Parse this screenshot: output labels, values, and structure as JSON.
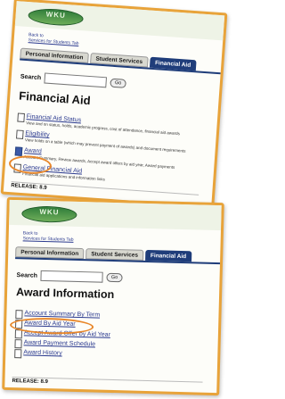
{
  "colors": {
    "highlight": "#e8a33a",
    "tab_active": "#1f3d7a",
    "link": "#2b3a8f",
    "logo_green": "#2f7d3a"
  },
  "screen1": {
    "logo": "WKU",
    "back_link": {
      "line1": "Back to",
      "line2": "Services for Students Tab"
    },
    "tabs": [
      {
        "label": "Personal Information"
      },
      {
        "label": "Student Services"
      },
      {
        "label": "Financial Aid"
      }
    ],
    "search": {
      "label": "Search",
      "placeholder": "",
      "go": "Go"
    },
    "title": "Financial Aid",
    "items": [
      {
        "label": "Financial Aid Status",
        "desc": "View and on status, holds, academic progress, cost of attendance, financial aid awards"
      },
      {
        "label": "Eligibility",
        "desc": "View holds on a table (which may prevent payment of awards) and document requirements"
      },
      {
        "label": "Award",
        "desc": "Account Summary, Review awards, Accept award offers by aid year, Award payments"
      },
      {
        "label": "General Financial Aid",
        "desc": "Financial aid applications and information links"
      }
    ],
    "release": "RELEASE: 8.9"
  },
  "screen2": {
    "logo": "WKU",
    "back_link": {
      "line1": "Back to",
      "line2": "Services for Students Tab"
    },
    "tabs": [
      {
        "label": "Personal Information"
      },
      {
        "label": "Student Services"
      },
      {
        "label": "Financial Aid"
      }
    ],
    "search": {
      "label": "Search",
      "placeholder": "",
      "go": "Go"
    },
    "title": "Award Information",
    "items": [
      {
        "label": "Account Summary By Term"
      },
      {
        "label": "Award By Aid Year"
      },
      {
        "label": "Accept Award Offer by Aid Year"
      },
      {
        "label": "Award Payment Schedule"
      },
      {
        "label": "Award History"
      }
    ],
    "release": "RELEASE: 8.9"
  }
}
